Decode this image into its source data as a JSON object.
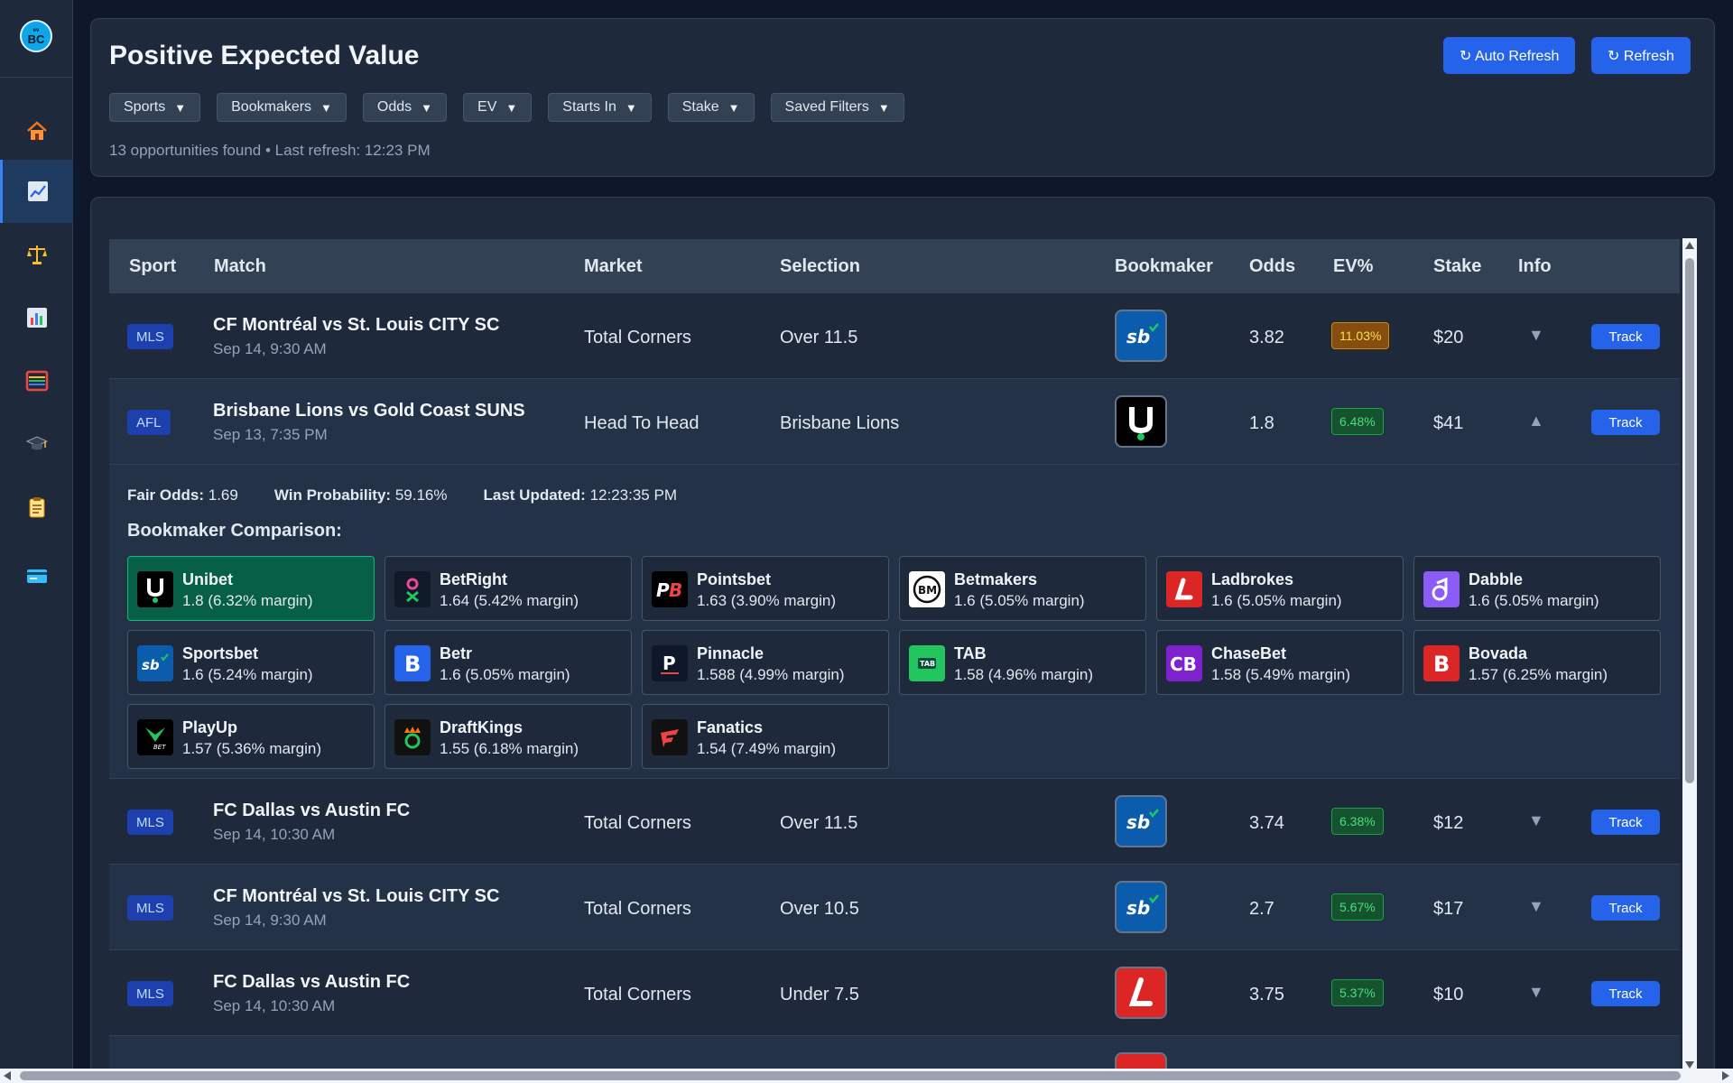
{
  "sidebar": {
    "logo_text": "BC",
    "logo_sub": "ev",
    "items": [
      {
        "name": "home",
        "icon": "house-icon"
      },
      {
        "name": "positive-ev",
        "icon": "chart-line-icon"
      },
      {
        "name": "arbitrage",
        "icon": "scales-icon"
      },
      {
        "name": "stats",
        "icon": "bar-chart-icon"
      },
      {
        "name": "calculator",
        "icon": "abacus-icon"
      },
      {
        "name": "learn",
        "icon": "graduation-cap-icon"
      },
      {
        "name": "history",
        "icon": "clipboard-icon"
      },
      {
        "name": "billing",
        "icon": "credit-card-icon"
      }
    ]
  },
  "header": {
    "title": "Positive Expected Value",
    "auto_refresh_label": "↻ Auto Refresh",
    "refresh_label": "↻ Refresh",
    "filters": [
      "Sports",
      "Bookmakers",
      "Odds",
      "EV",
      "Starts In",
      "Stake",
      "Saved Filters"
    ],
    "status": "13 opportunities found • Last refresh: 12:23 PM"
  },
  "table": {
    "columns": [
      "Sport",
      "Match",
      "Market",
      "Selection",
      "Bookmaker",
      "Odds",
      "EV%",
      "Stake",
      "Info"
    ],
    "track_label": "Track",
    "rows": [
      {
        "sport": "MLS",
        "match": "CF Montréal vs St. Louis CITY SC",
        "date": "Sep 14, 9:30 AM",
        "market": "Total Corners",
        "selection": "Over 11.5",
        "bookmaker": "sportsbet",
        "odds": "3.82",
        "ev": "11.03%",
        "ev_level": "yellow",
        "stake": "$20",
        "info": "▼"
      },
      {
        "sport": "AFL",
        "match": "Brisbane Lions vs Gold Coast SUNS",
        "date": "Sep 13, 7:35 PM",
        "market": "Head To Head",
        "selection": "Brisbane Lions",
        "bookmaker": "unibet",
        "odds": "1.8",
        "ev": "6.48%",
        "ev_level": "green",
        "stake": "$41",
        "info": "▲"
      },
      {
        "sport": "MLS",
        "match": "FC Dallas vs Austin FC",
        "date": "Sep 14, 10:30 AM",
        "market": "Total Corners",
        "selection": "Over 11.5",
        "bookmaker": "sportsbet",
        "odds": "3.74",
        "ev": "6.38%",
        "ev_level": "green",
        "stake": "$12",
        "info": "▼"
      },
      {
        "sport": "MLS",
        "match": "CF Montréal vs St. Louis CITY SC",
        "date": "Sep 14, 9:30 AM",
        "market": "Total Corners",
        "selection": "Over 10.5",
        "bookmaker": "sportsbet",
        "odds": "2.7",
        "ev": "5.67%",
        "ev_level": "green",
        "stake": "$17",
        "info": "▼"
      },
      {
        "sport": "MLS",
        "match": "FC Dallas vs Austin FC",
        "date": "Sep 14, 10:30 AM",
        "market": "Total Corners",
        "selection": "Under 7.5",
        "bookmaker": "ladbrokes",
        "odds": "3.75",
        "ev": "5.37%",
        "ev_level": "green",
        "stake": "$10",
        "info": "▼"
      }
    ]
  },
  "expanded": {
    "fair_odds_label": "Fair Odds:",
    "fair_odds": "1.69",
    "win_prob_label": "Win Probability:",
    "win_prob": "59.16%",
    "last_updated_label": "Last Updated:",
    "last_updated": "12:23:35 PM",
    "comparison_title": "Bookmaker Comparison:",
    "bookmakers": [
      {
        "name": "Unibet",
        "value": "1.8 (6.32% margin)",
        "logo": "unibet",
        "best": true
      },
      {
        "name": "BetRight",
        "value": "1.64 (5.42% margin)",
        "logo": "betright"
      },
      {
        "name": "Pointsbet",
        "value": "1.63 (3.90% margin)",
        "logo": "pointsbet"
      },
      {
        "name": "Betmakers",
        "value": "1.6 (5.05% margin)",
        "logo": "betmakers"
      },
      {
        "name": "Ladbrokes",
        "value": "1.6 (5.05% margin)",
        "logo": "ladbrokes"
      },
      {
        "name": "Dabble",
        "value": "1.6 (5.05% margin)",
        "logo": "dabble"
      },
      {
        "name": "Sportsbet",
        "value": "1.6 (5.24% margin)",
        "logo": "sportsbet"
      },
      {
        "name": "Betr",
        "value": "1.6 (5.05% margin)",
        "logo": "betr"
      },
      {
        "name": "Pinnacle",
        "value": "1.588 (4.99% margin)",
        "logo": "pinnacle"
      },
      {
        "name": "TAB",
        "value": "1.58 (4.96% margin)",
        "logo": "tab"
      },
      {
        "name": "ChaseBet",
        "value": "1.58 (5.49% margin)",
        "logo": "chasebet"
      },
      {
        "name": "Bovada",
        "value": "1.57 (6.25% margin)",
        "logo": "bovada"
      },
      {
        "name": "PlayUp",
        "value": "1.57 (5.36% margin)",
        "logo": "playup"
      },
      {
        "name": "DraftKings",
        "value": "1.55 (6.18% margin)",
        "logo": "draftkings"
      },
      {
        "name": "Fanatics",
        "value": "1.54 (7.49% margin)",
        "logo": "fanatics"
      }
    ]
  },
  "colors": {
    "accent": "#2563eb",
    "bg": "#0f172a",
    "panel": "#1e293b",
    "best_card": "#065f46"
  }
}
